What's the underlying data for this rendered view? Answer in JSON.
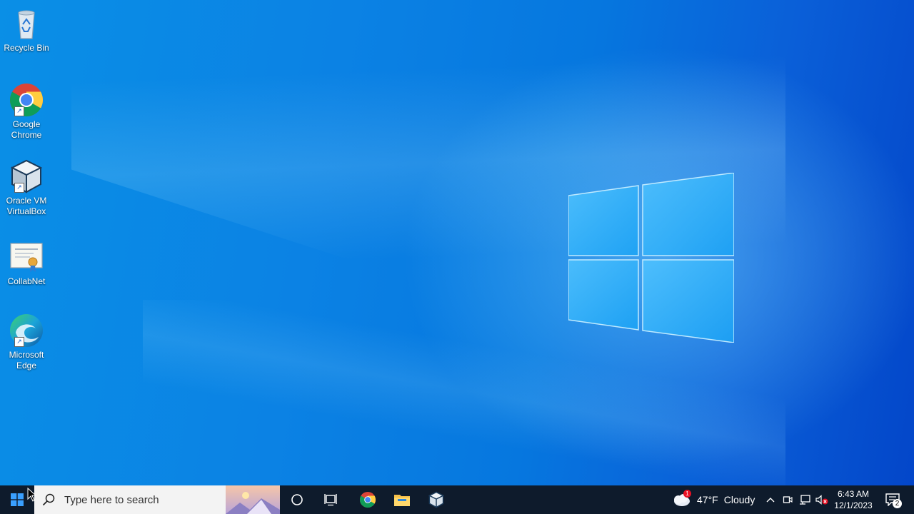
{
  "desktop": {
    "icons": [
      {
        "label": "Recycle Bin",
        "icon": "recycle-bin-icon",
        "shortcut": false
      },
      {
        "label": "Google Chrome",
        "icon": "chrome-icon",
        "shortcut": true
      },
      {
        "label": "Oracle VM VirtualBox",
        "icon": "virtualbox-icon",
        "shortcut": true
      },
      {
        "label": "CollabNet",
        "icon": "certificate-icon",
        "shortcut": false
      },
      {
        "label": "Microsoft Edge",
        "icon": "edge-icon",
        "shortcut": true
      }
    ],
    "label_lines": {
      "recycle": [
        "Recycle Bin"
      ],
      "chrome": [
        "Google",
        "Chrome"
      ],
      "vbox": [
        "Oracle VM",
        "VirtualBox"
      ],
      "collabnet": [
        "CollabNet"
      ],
      "edge": [
        "Microsoft",
        "Edge"
      ]
    }
  },
  "taskbar": {
    "search": {
      "placeholder": "Type here to search"
    },
    "pinned": [
      "cortana-icon",
      "task-view-icon",
      "chrome-icon",
      "file-explorer-icon",
      "virtualbox-icon"
    ],
    "weather": {
      "temp": "47°F",
      "condition": "Cloudy",
      "alert_count": "1"
    },
    "clock": {
      "time": "6:43 AM",
      "date": "12/1/2023"
    },
    "notifications": {
      "count": "2"
    }
  },
  "colors": {
    "desktop_accent": "#0a7fe2",
    "taskbar_bg": "#0e1b2c",
    "search_bg": "#f3f3f3",
    "badge_red": "#e81123"
  }
}
